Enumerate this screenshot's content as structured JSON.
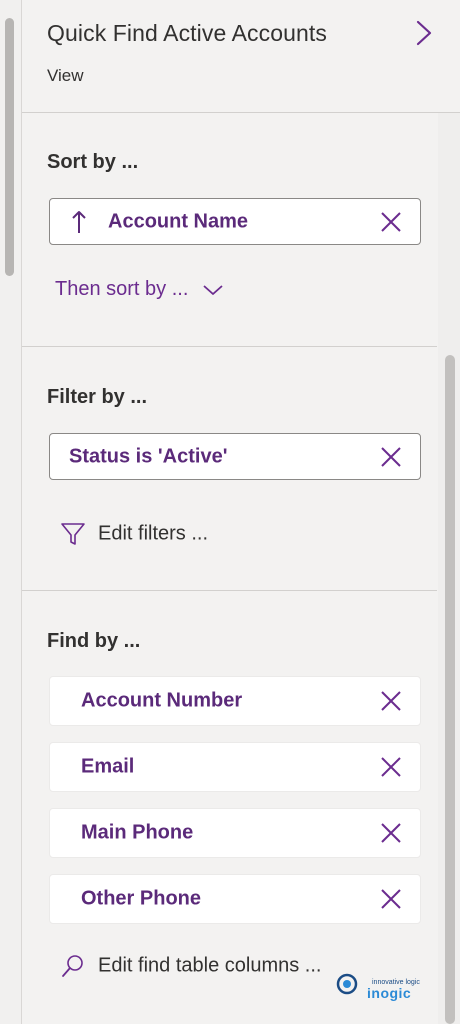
{
  "header": {
    "title": "Quick Find Active Accounts",
    "subtitle": "View"
  },
  "sort": {
    "title": "Sort by ...",
    "primary": {
      "label": "Account Name",
      "direction": "ascending"
    },
    "then_label": "Then sort by ..."
  },
  "filter": {
    "title": "Filter by ...",
    "chip": {
      "label": "Status is 'Active'"
    },
    "edit_label": "Edit filters ..."
  },
  "find": {
    "title": "Find by ...",
    "columns": [
      {
        "label": "Account Number"
      },
      {
        "label": "Email"
      },
      {
        "label": "Main Phone"
      },
      {
        "label": "Other Phone"
      }
    ],
    "edit_label": "Edit find table columns ..."
  },
  "watermark": {
    "tagline": "innovative logic",
    "word": "inogic"
  },
  "icons": {
    "expand": "chevron-right-icon",
    "remove": "close-icon",
    "sort_dir": "arrow-up-icon",
    "then_sort": "chevron-down-icon",
    "filter": "funnel-icon",
    "find": "search-icon"
  },
  "colors": {
    "accent": "#6b2c8f",
    "chip_text": "#5b2a7a",
    "panel_bg": "#f3f2f1",
    "text": "#323130"
  }
}
